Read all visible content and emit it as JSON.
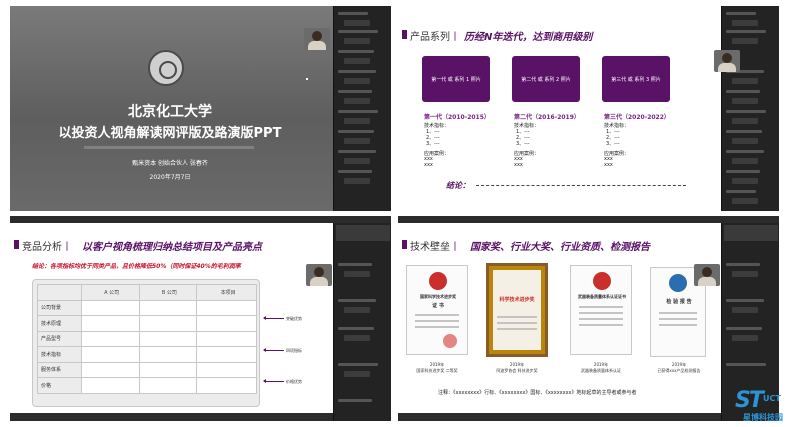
{
  "slide1": {
    "title_line1": "北京化工大学",
    "title_line2": "以投资人视角解读网评版及路演版PPT",
    "subtitle": "甄米资本 创始合伙人 张春齐",
    "date": "2020年7月7日"
  },
  "slide2": {
    "section": "产品系列",
    "separator": "丨",
    "headline": "历经N年迭代，达到商用级别",
    "generations": [
      {
        "box": "第一代 或 系列 1 照片",
        "label": "第一代（2010-2015）",
        "spec_label": "技术指标：",
        "specs": [
          "1、---",
          "2、---",
          "3、---"
        ],
        "case_label": "应用案例：",
        "cases": [
          "xxx",
          "xxx"
        ]
      },
      {
        "box": "第二代 或 系列 2 照片",
        "label": "第二代（2016-2019）",
        "spec_label": "技术指标：",
        "specs": [
          "1、---",
          "2、---",
          "3、---"
        ],
        "case_label": "应用案例：",
        "cases": [
          "xxx",
          "xxx"
        ]
      },
      {
        "box": "第三代 或 系列 3 照片",
        "label": "第三代（2020-2022）",
        "spec_label": "技术指标：",
        "specs": [
          "1、---",
          "2、---",
          "3、---"
        ],
        "case_label": "应用案例：",
        "cases": [
          "xxx",
          "xxx"
        ]
      }
    ],
    "conclusion": "结论："
  },
  "slide3": {
    "section": "竞品分析",
    "separator": "丨",
    "headline": "以客户视角梳理归纳总结项目及产品亮点",
    "note": "结论：各项指标均优于同类产品，且价格降低50%（同时保证40%的毛利润率",
    "columns": [
      "",
      "A 公司",
      "B 公司",
      "本项目"
    ],
    "rows": [
      "公司背景",
      "技术原理",
      "产品型号",
      "技术指标",
      "服务体系",
      "价格"
    ],
    "callouts": [
      "突破优势",
      "四项指标",
      "价格优势"
    ]
  },
  "slide4": {
    "section": "技术壁垒",
    "separator": "丨",
    "headline": "国家奖、行业大奖、行业资质、检测报告",
    "certs": [
      {
        "title": "国家科学技术进步奖",
        "big": "证 书",
        "year": "2019年",
        "caption": "国家科技进步奖 二等奖"
      },
      {
        "title": "科学技术进步奖",
        "big": "科学技术进步奖",
        "year": "2019年",
        "caption": "阿波罗协会 科技进步奖"
      },
      {
        "title": "武器装备质量体系认证证书",
        "big": "",
        "year": "2019年",
        "caption": "武器装备质量体系认证"
      },
      {
        "title": "检 验 报 告",
        "big": "检 验 报 告",
        "year": "2019年",
        "caption": "已获得xxx产品检测报告"
      }
    ],
    "footer": "注释：《xxxxxxxx》行标、《xxxxxxxx》国标、《xxxxxxxx》地标起草的主导者或参与者"
  },
  "logo": {
    "mark": "ST",
    "suffix": "UCT",
    "name": "星博科技园"
  },
  "colors": {
    "accent": "#5a1267",
    "warn": "#c8102e",
    "brand": "#2a95d6"
  }
}
